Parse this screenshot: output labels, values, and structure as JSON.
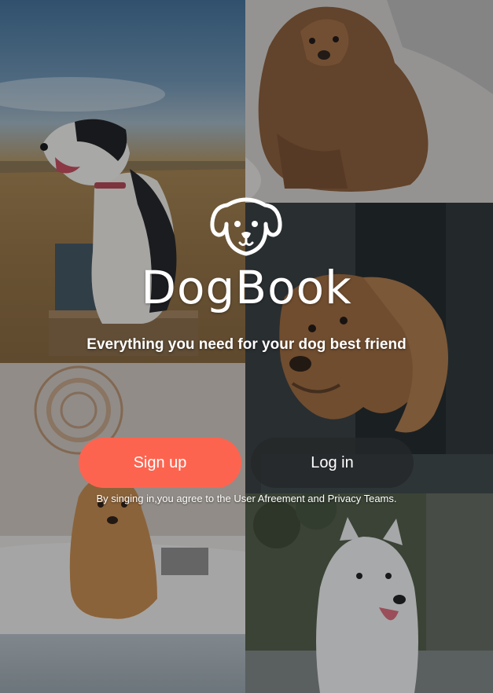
{
  "app": {
    "brand_name": "DogBook",
    "tagline": "Everything you need for your dog best friend"
  },
  "actions": {
    "signup_label": "Sign up",
    "login_label": "Log in"
  },
  "legal": {
    "text": "By singing in,you agree to the User Afreement and Privacy Teams."
  },
  "icons": {
    "logo": "dog-face-icon"
  },
  "colors": {
    "accent": "#fd6450",
    "login_button": "#26282a",
    "text": "#ffffff"
  },
  "photos": [
    "border-collie-photo",
    "poodle-photo",
    "spaniel-photo",
    "goldendoodle-photo",
    "samoyed-photo"
  ]
}
